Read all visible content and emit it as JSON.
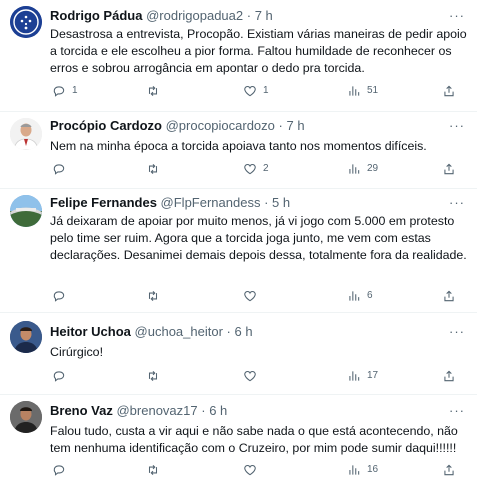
{
  "tweets": [
    {
      "name": "Rodrigo Pádua",
      "handle": "@rodrigopadua2",
      "dot": "·",
      "time": "7 h",
      "text": "Desastrosa a entrevista, Procopão. Existiam várias maneiras de pedir apoio a torcida e ele escolheu a pior forma. Faltou humildade de reconhecer os erros e sobrou arrogância em apontar o dedo pra torcida.",
      "reply": "1",
      "retweet": "",
      "like": "1",
      "views": "51",
      "avatar": "cruzeiro-crest"
    },
    {
      "name": "Procópio Cardozo",
      "handle": "@procopiocardozo",
      "dot": "·",
      "time": "7 h",
      "text": "Nem na minha época a torcida apoiava tanto nos momentos difíceis.",
      "reply": "",
      "retweet": "",
      "like": "2",
      "views": "29",
      "avatar": "person-portrait"
    },
    {
      "name": "Felipe Fernandes",
      "handle": "@FlpFernandess",
      "dot": "·",
      "time": "5 h",
      "text": "Já deixaram de apoiar por muito menos, já vi jogo com 5.000 em protesto pelo time ser ruim. Agora que a torcida joga junto, me vem com estas declarações. Desanimei demais depois dessa, totalmente fora da realidade.",
      "reply": "",
      "retweet": "",
      "like": "",
      "views": "6",
      "avatar": "stadium-photo"
    },
    {
      "name": "Heitor Uchoa",
      "handle": "@uchoa_heitor",
      "dot": "·",
      "time": "6 h",
      "text": "Cirúrgico!",
      "reply": "",
      "retweet": "",
      "like": "",
      "views": "17",
      "avatar": "person-photo"
    },
    {
      "name": "Breno Vaz",
      "handle": "@brenovaz17",
      "dot": "·",
      "time": "6 h",
      "text": "Falou tudo, custa a vir aqui e não sabe nada o que está acontecendo, não tem nenhuma identificação com o Cruzeiro, por mim pode sumir daqui!!!!!!",
      "reply": "",
      "retweet": "",
      "like": "",
      "views": "16",
      "avatar": "person-photo"
    }
  ],
  "more_label": "···",
  "colors": {
    "text": "#0f1419",
    "muted": "#536471",
    "divider": "#eff3f4",
    "cruzeiro_blue": "#1c3f94"
  }
}
